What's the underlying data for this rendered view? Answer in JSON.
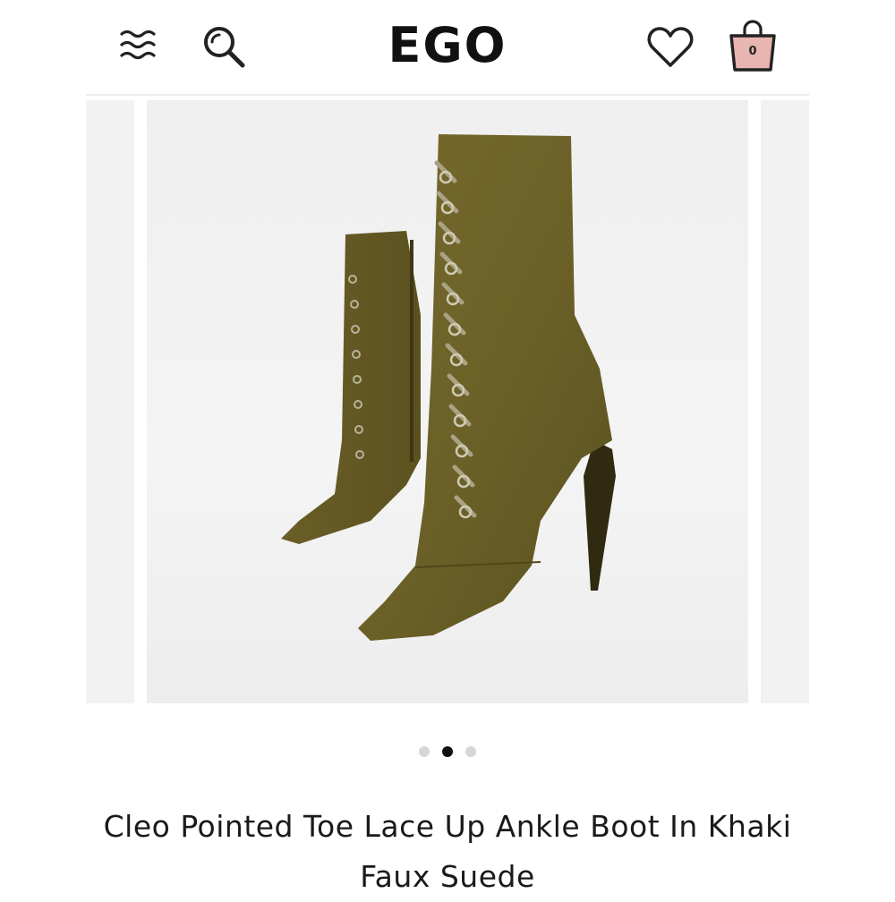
{
  "header": {
    "logo_text": "EGO",
    "menu_icon": "menu-icon",
    "search_icon": "search-icon",
    "wishlist_icon": "heart-icon",
    "bag_icon": "shopping-bag-icon",
    "bag_count": "0"
  },
  "gallery": {
    "active_slide": 2,
    "slide_count": 3,
    "image_description": "Khaki faux suede pointed toe lace-up stiletto ankle boots"
  },
  "product": {
    "title": "Cleo Pointed Toe Lace Up Ankle Boot In Khaki Faux Suede"
  },
  "colors": {
    "bag_fill": "#e8b5b0",
    "boot_khaki": "#6b6128",
    "dot_active": "#111111",
    "dot_inactive": "#d6d6d6"
  }
}
